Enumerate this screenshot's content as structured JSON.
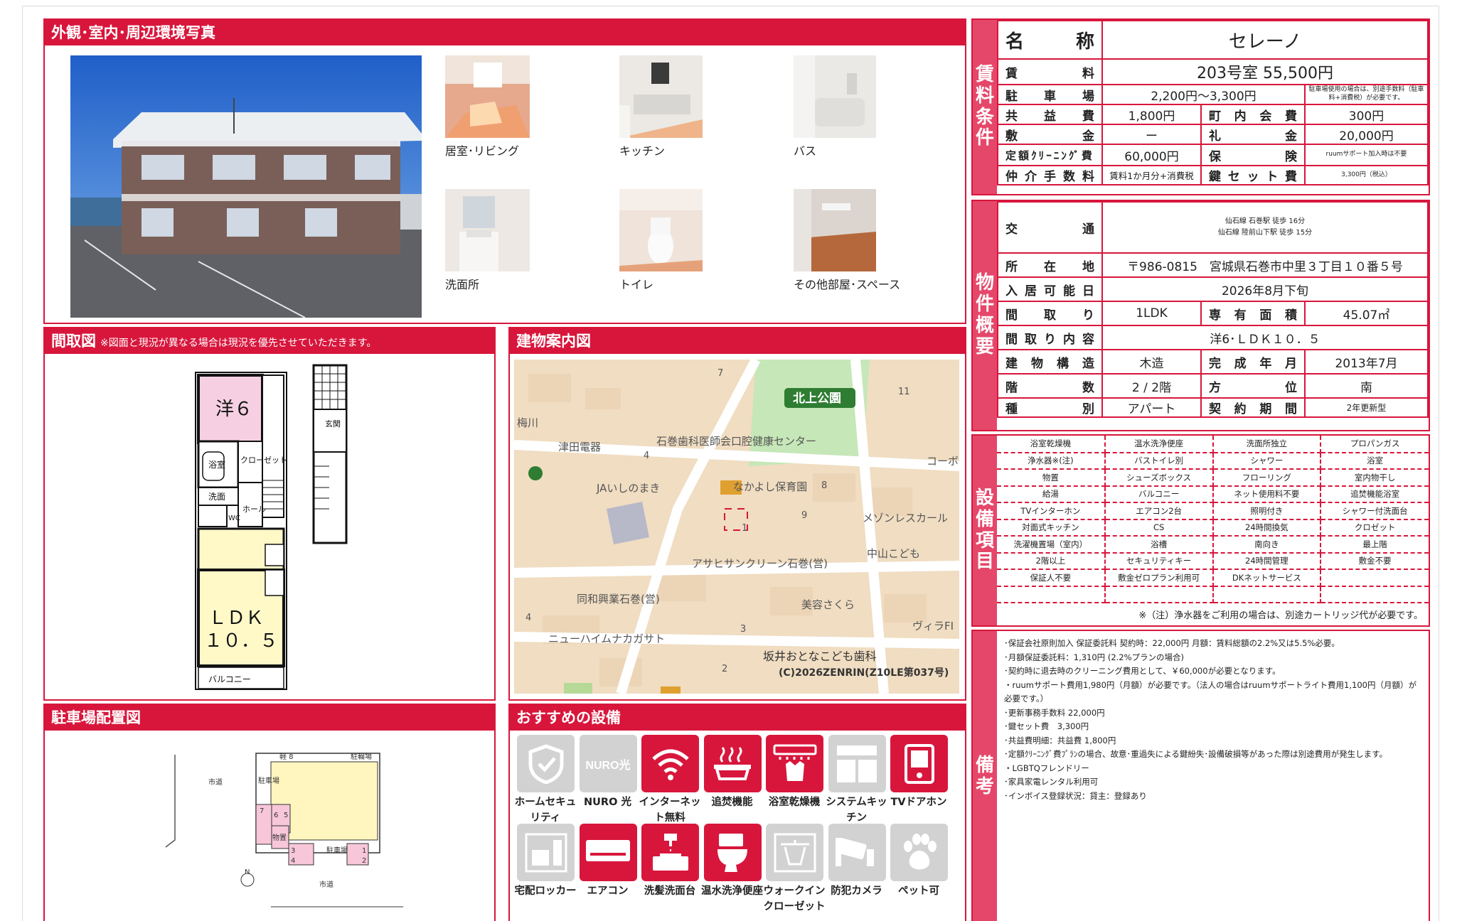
{
  "photos": {
    "heading": "外観･室内･周辺環境写真",
    "captions": [
      "居室･リビング",
      "キッチン",
      "バス",
      "洗面所",
      "トイレ",
      "その他部屋･スペース"
    ]
  },
  "floorplan": {
    "heading": "間取図",
    "note": "※図面と現況が異なる場合は現況を優先させていただきます。",
    "room_western": "洋６",
    "room_ldk_1": "ＬＤＫ",
    "room_ldk_2": "１０．５",
    "bath": "浴室",
    "closet": "クローゼット",
    "washroom": "洗面",
    "wc": "WC",
    "hall": "ホール",
    "balcony": "バルコニー",
    "entrance": "玄関"
  },
  "map": {
    "heading": "建物案内図",
    "labels": [
      "北上公園",
      "津田電器",
      "石巻歯科医師会口腔健康センター",
      "JAいしのまき",
      "なかよし保育園",
      "メゾンレスカール",
      "中山こども",
      "アサヒサンクリーン石巻(営)",
      "同和興業石巻(営)",
      "美容さくら",
      "ニューハイムナカガサト",
      "ヴィラFI",
      "坂井おとなこども歯科",
      "(C)2026ZENRIN(Z10LE第037号)",
      "コーボ",
      "梅川",
      "7",
      "11",
      "4",
      "9",
      "8",
      "1",
      "3",
      "2",
      "4"
    ]
  },
  "parking": {
    "heading": "駐車場配置図",
    "labels": [
      "市道",
      "軽 8",
      "駐輪場",
      "駐車場",
      "7",
      "6",
      "5",
      "物置",
      "3",
      "4",
      "駐車場",
      "1",
      "2",
      "N",
      "市道"
    ]
  },
  "features": {
    "heading": "おすすめの設備",
    "items": [
      {
        "label": "ホームセキュリティ",
        "on": false
      },
      {
        "label": "NURO 光",
        "on": false,
        "text": "NURO光"
      },
      {
        "label": "インターネット無料",
        "on": true
      },
      {
        "label": "追焚機能",
        "on": true
      },
      {
        "label": "浴室乾燥機",
        "on": true
      },
      {
        "label": "システムキッチン",
        "on": false
      },
      {
        "label": "TVドアホン",
        "on": true
      },
      {
        "label": "宅配ロッカー",
        "on": false
      },
      {
        "label": "エアコン",
        "on": true
      },
      {
        "label": "洗髪洗面台",
        "on": true
      },
      {
        "label": "温水洗浄便座",
        "on": true
      },
      {
        "label": "ウォークインクローゼット",
        "on": false
      },
      {
        "label": "防犯カメラ",
        "on": false
      },
      {
        "label": "ペット可",
        "on": false
      }
    ]
  },
  "rent": {
    "side": [
      "賃",
      "料",
      "条",
      "件"
    ],
    "name_label": "名　　称",
    "name": "セレーノ",
    "rent_label": "賃　　料",
    "rent": "203号室 55,500円",
    "parking_label": "駐車場",
    "parking": "2,200円～3,300円",
    "parking_note": "駐車場使用の場合は、別途手数料（駐車料+消費税）が必要です。",
    "common_label": "共益費",
    "common": "1,800円",
    "town_label": "町内会費",
    "town": "300円",
    "deposit_label": "敷金",
    "deposit": "ー",
    "key_money_label": "礼金",
    "key_money": "20,000円",
    "cleaning_label": "定額ｸﾘｰﾆﾝｸﾞ費",
    "cleaning": "60,000円",
    "insurance_label": "保険",
    "insurance": "ruumサポート加入時は不要",
    "brokerage_label": "仲介手数料",
    "brokerage": "賃料1か月分+消費税",
    "keyset_label": "鍵セット費",
    "keyset": "3,300円（税込）"
  },
  "property": {
    "side": [
      "物",
      "件",
      "概",
      "要"
    ],
    "traffic_label": "交　通",
    "traffic_1": "仙石線 石巻駅 徒歩 16分",
    "traffic_2": "仙石線 陸前山下駅 徒歩 15分",
    "address_label": "所在地",
    "address": "〒986-0815　宮城県石巻市中里３丁目１０番５号",
    "movein_label": "入居可能日",
    "movein": "2026年8月下旬",
    "layout_label": "間取り",
    "layout": "1LDK",
    "area_label": "専有面積",
    "area": "45.07㎡",
    "detail_label": "間取り内容",
    "detail": "洋6･ＬＤＫ１０．５",
    "structure_label": "建物構造",
    "structure": "木造",
    "built_label": "完成年月",
    "built": "2013年7月",
    "floor_label": "階数",
    "floor": "2 / 2階",
    "direction_label": "方位",
    "direction": "南",
    "type_label": "種別",
    "type": "アパート",
    "contract_label": "契約期間",
    "contract": "2年更新型"
  },
  "equipment": {
    "side": [
      "設",
      "備",
      "項",
      "目"
    ],
    "rows": [
      [
        "浴室乾燥機",
        "温水洗浄便座",
        "洗面所独立",
        "プロパンガス"
      ],
      [
        "浄水器※(注)",
        "バストイレ別",
        "シャワー",
        "浴室"
      ],
      [
        "物置",
        "シューズボックス",
        "フローリング",
        "室内物干し"
      ],
      [
        "給湯",
        "バルコニー",
        "ネット使用料不要",
        "追焚機能浴室"
      ],
      [
        "TVインターホン",
        "エアコン2台",
        "照明付き",
        "シャワー付洗面台"
      ],
      [
        "対面式キッチン",
        "CS",
        "24時間換気",
        "クロゼット"
      ],
      [
        "洗濯機置場（室内）",
        "浴槽",
        "南向き",
        "最上階"
      ],
      [
        "2階以上",
        "セキュリティキー",
        "24時間管理",
        "敷金不要"
      ],
      [
        "保証人不要",
        "敷金ゼロプラン利用可",
        "DKネットサービス",
        ""
      ],
      [
        "",
        "",
        "",
        ""
      ]
    ],
    "note": "※（注）浄水器をご利用の場合は、別途カートリッジ代が必要です。"
  },
  "remarks": {
    "side": [
      "備",
      "考"
    ],
    "lines": [
      "･保証会社原則加入 保証委託料 契約時：22,000円 月額：賃料総額の2.2%又は5.5%必要。",
      "･月額保証委託料：1,310円 (2.2%プランの場合)",
      "･契約時に退去時のクリーニング費用として、￥60,000が必要となります。",
      "・ruumサポート費用1,980円（月額）が必要です。（法人の場合はruumサポートライト費用1,100円（月額）が必要です。）",
      "･更新事務手数料 22,000円",
      "･鍵セット費　3,300円",
      "･共益費明細：共益費 1,800円",
      "･定額ｸﾘｰﾆﾝｸﾞ費ﾌﾟﾗﾝの場合、故意･重過失による鍵紛失･設備破損等があった際は別途費用が発生します。",
      "・LGBTQフレンドリー",
      "･家具家電レンタル利用可",
      "･インボイス登録状況：貸主：登録あり"
    ]
  }
}
